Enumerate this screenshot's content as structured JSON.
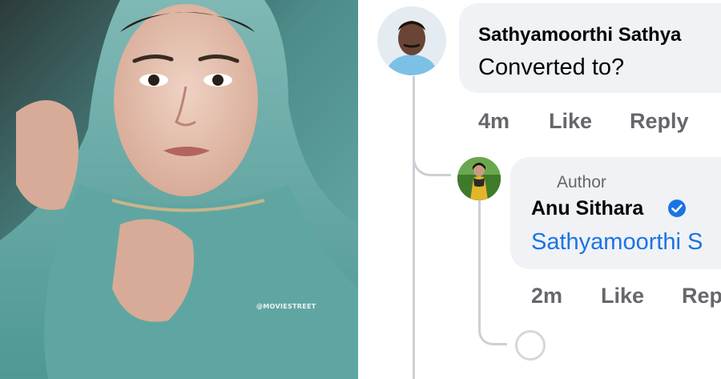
{
  "photo": {
    "watermark": "@MOVIESTREET"
  },
  "comments": [
    {
      "author": "Sathyamoorthi Sathya",
      "text": "Converted to?",
      "time": "4m",
      "like_label": "Like",
      "reply_label": "Reply"
    }
  ],
  "reply": {
    "badge": "Author",
    "author": "Anu Sithara",
    "verified": true,
    "mention": "Sathyamoorthi S",
    "time": "2m",
    "like_label": "Like",
    "reply_label": "Reply"
  },
  "colors": {
    "bubble": "#f0f2f5",
    "action_text": "#65676b",
    "mention": "#1b74e4",
    "verified_badge": "#1b74e4",
    "thread_line": "#ccd0d5"
  }
}
